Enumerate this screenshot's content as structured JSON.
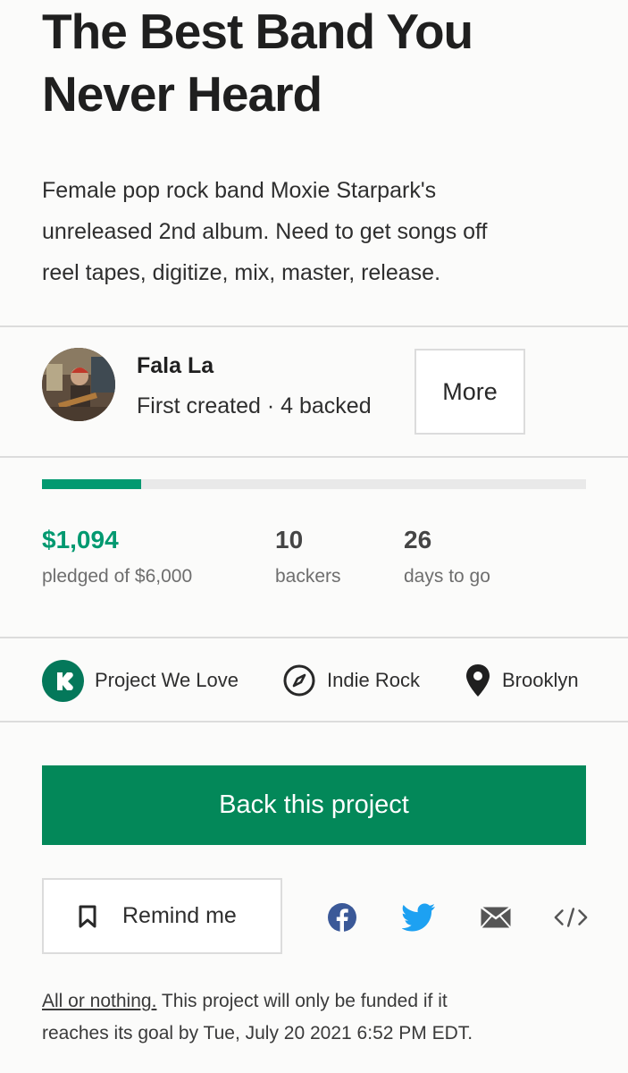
{
  "project": {
    "title_line1": "The Best Band You",
    "title_line2": "Never Heard",
    "blurb_line1": "Female pop rock band Moxie Starpark's",
    "blurb_line2": "unreleased 2nd album. Need to get songs off",
    "blurb_line3": "reel tapes, digitize, mix, master, release."
  },
  "creator": {
    "name": "Fala La",
    "meta": "First created · 4 backed",
    "more_label": "More"
  },
  "funding": {
    "progress_fraction": 0.182,
    "pledged": "$1,094",
    "pledged_label": "pledged of $6,000",
    "backers": "10",
    "backers_label": "backers",
    "days": "26",
    "days_label": "days to go",
    "accent_color": "#019970"
  },
  "tags": [
    {
      "label": "Project We Love",
      "icon": "kickstarter-badge-icon"
    },
    {
      "label": "Indie Rock",
      "icon": "compass-icon"
    },
    {
      "label": "Brooklyn",
      "icon": "location-pin-icon"
    }
  ],
  "actions": {
    "back_label": "Back this project",
    "back_color": "#038859",
    "remind_label": "Remind me",
    "share": [
      {
        "icon": "facebook-icon",
        "color": "#3b5998"
      },
      {
        "icon": "twitter-icon",
        "color": "#1da1f2"
      },
      {
        "icon": "email-icon",
        "color": "#555555"
      },
      {
        "icon": "embed-icon",
        "color": "#555555"
      }
    ]
  },
  "footnote": {
    "link": "All or nothing.",
    "text_line1": " This project will only be funded if it",
    "text_line2": "reaches its goal by Tue, July 20 2021 6:52 PM EDT."
  }
}
